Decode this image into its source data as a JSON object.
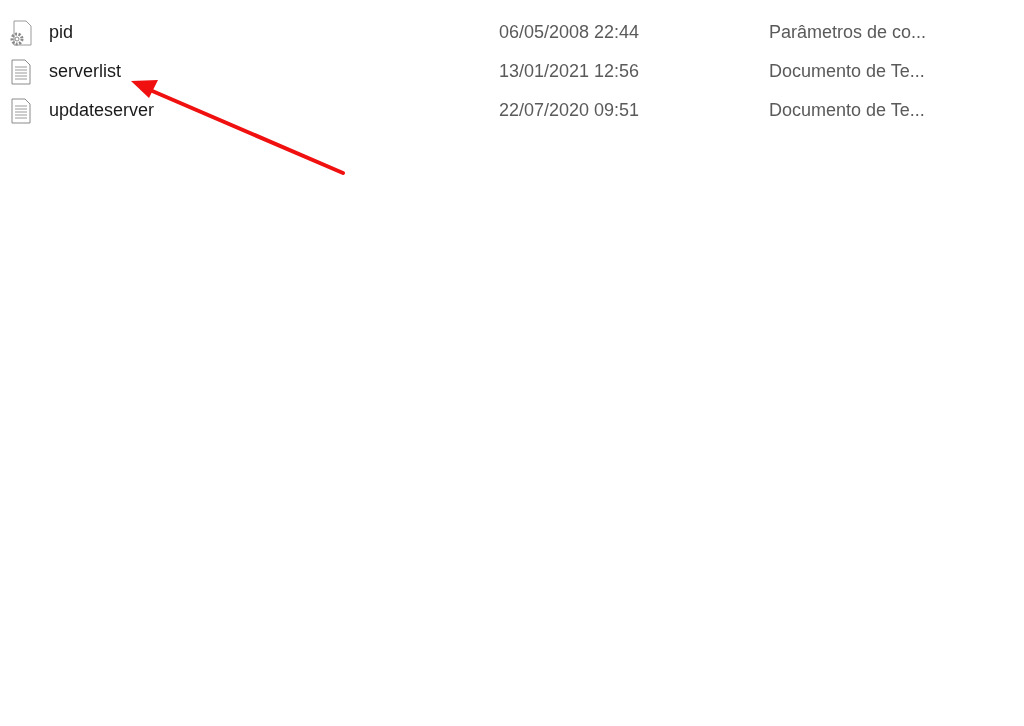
{
  "files": [
    {
      "name": "pid",
      "kind": "settings",
      "modified": "06/05/2008 22:44",
      "type": "Parâmetros de co..."
    },
    {
      "name": "serverlist",
      "kind": "text",
      "modified": "13/01/2021 12:56",
      "type": "Documento de Te..."
    },
    {
      "name": "updateserver",
      "kind": "text",
      "modified": "22/07/2020 09:51",
      "type": "Documento de Te..."
    }
  ]
}
